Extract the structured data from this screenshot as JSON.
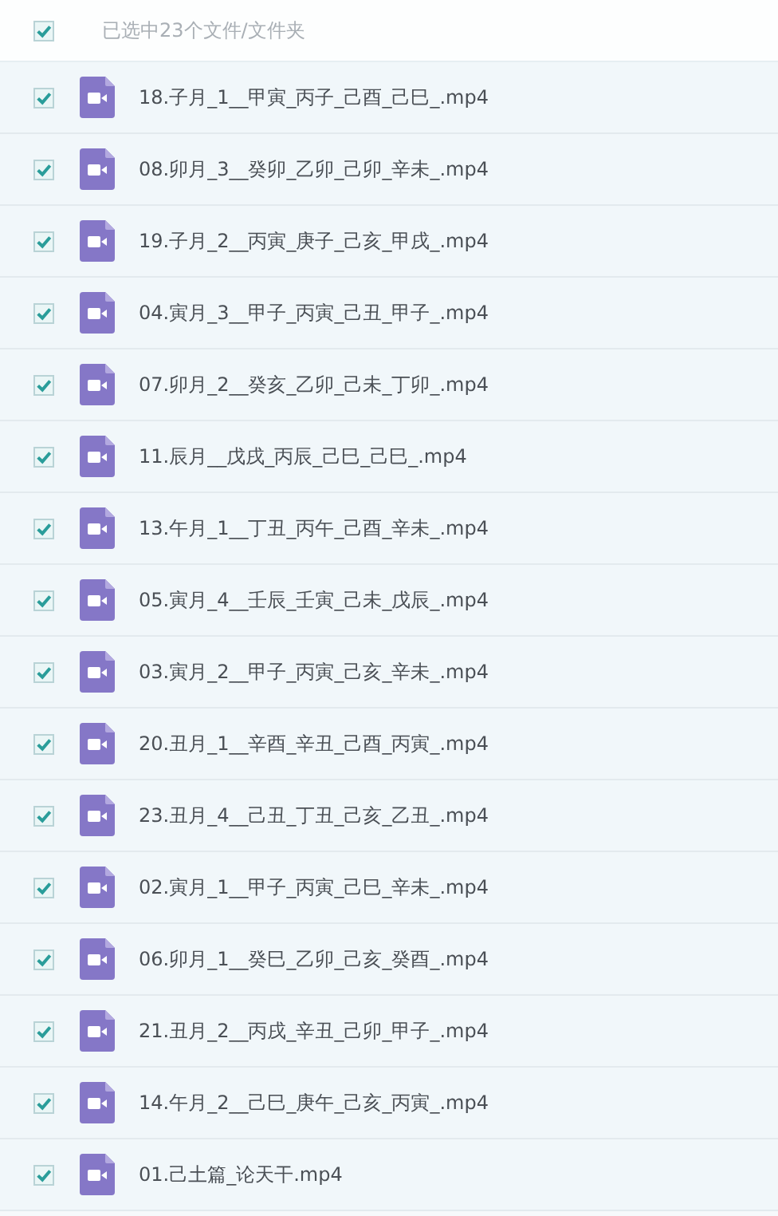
{
  "header": {
    "checked": true,
    "label": "已选中23个文件/文件夹"
  },
  "files": [
    {
      "name": "18.子月_1__甲寅_丙子_己酉_己巳_.mp4",
      "checked": true
    },
    {
      "name": "08.卯月_3__癸卯_乙卯_己卯_辛未_.mp4",
      "checked": true
    },
    {
      "name": "19.子月_2__丙寅_庚子_己亥_甲戌_.mp4",
      "checked": true
    },
    {
      "name": "04.寅月_3__甲子_丙寅_己丑_甲子_.mp4",
      "checked": true
    },
    {
      "name": "07.卯月_2__癸亥_乙卯_己未_丁卯_.mp4",
      "checked": true
    },
    {
      "name": "11.辰月__戊戌_丙辰_己巳_己巳_.mp4",
      "checked": true
    },
    {
      "name": "13.午月_1__丁丑_丙午_己酉_辛未_.mp4",
      "checked": true
    },
    {
      "name": "05.寅月_4__壬辰_壬寅_己未_戊辰_.mp4",
      "checked": true
    },
    {
      "name": "03.寅月_2__甲子_丙寅_己亥_辛未_.mp4",
      "checked": true
    },
    {
      "name": "20.丑月_1__辛酉_辛丑_己酉_丙寅_.mp4",
      "checked": true
    },
    {
      "name": "23.丑月_4__己丑_丁丑_己亥_乙丑_.mp4",
      "checked": true
    },
    {
      "name": "02.寅月_1__甲子_丙寅_己巳_辛未_.mp4",
      "checked": true
    },
    {
      "name": "06.卯月_1__癸巳_乙卯_己亥_癸酉_.mp4",
      "checked": true
    },
    {
      "name": "21.丑月_2__丙戌_辛丑_己卯_甲子_.mp4",
      "checked": true
    },
    {
      "name": "14.午月_2__己巳_庚午_己亥_丙寅_.mp4",
      "checked": true
    },
    {
      "name": "01.己土篇_论天干.mp4",
      "checked": true
    }
  ]
}
